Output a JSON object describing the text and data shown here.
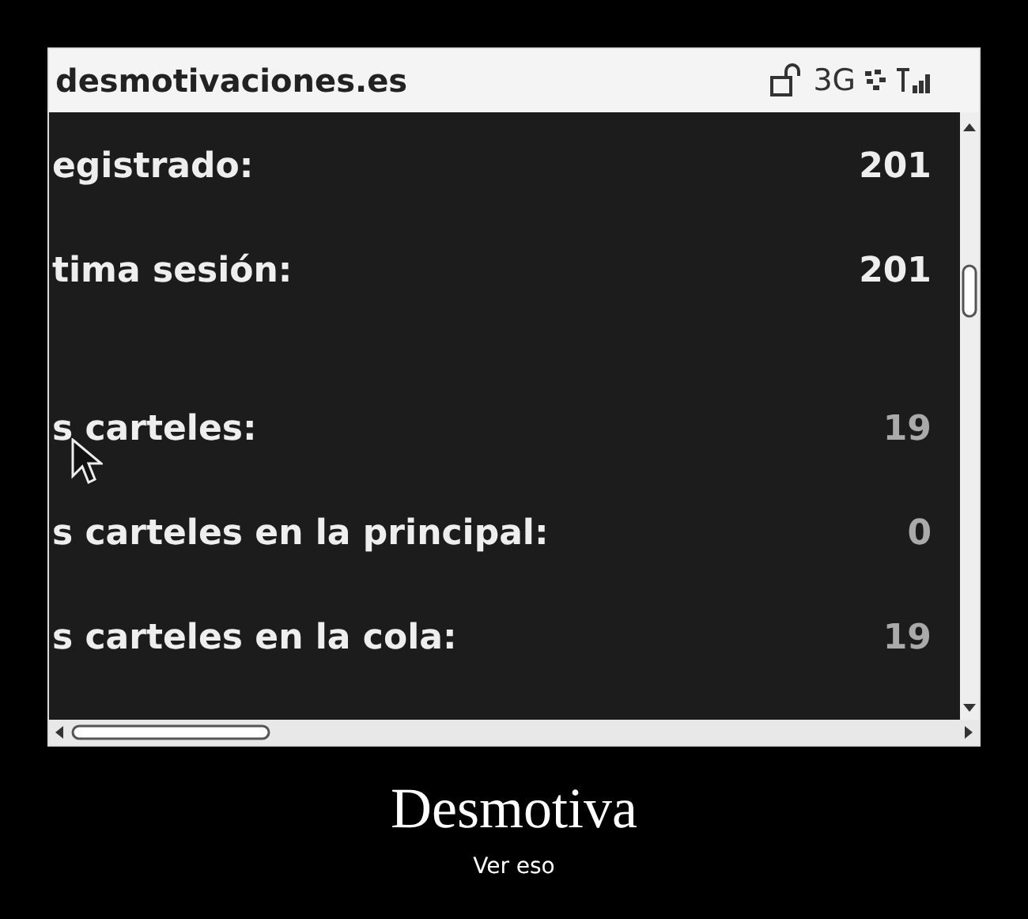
{
  "screen": {
    "header": {
      "title": "desmotivaciones.es",
      "network": "3G"
    },
    "rows": [
      {
        "label": "egistrado:",
        "value": "201"
      },
      {
        "label": "tima sesión:",
        "value": "201"
      },
      {
        "label": "s carteles:",
        "value": "19"
      },
      {
        "label": "s carteles en la principal:",
        "value": "0"
      },
      {
        "label": "s carteles en la cola:",
        "value": "19"
      }
    ]
  },
  "caption": {
    "title": "Desmotiva",
    "subtitle": "Ver eso"
  }
}
